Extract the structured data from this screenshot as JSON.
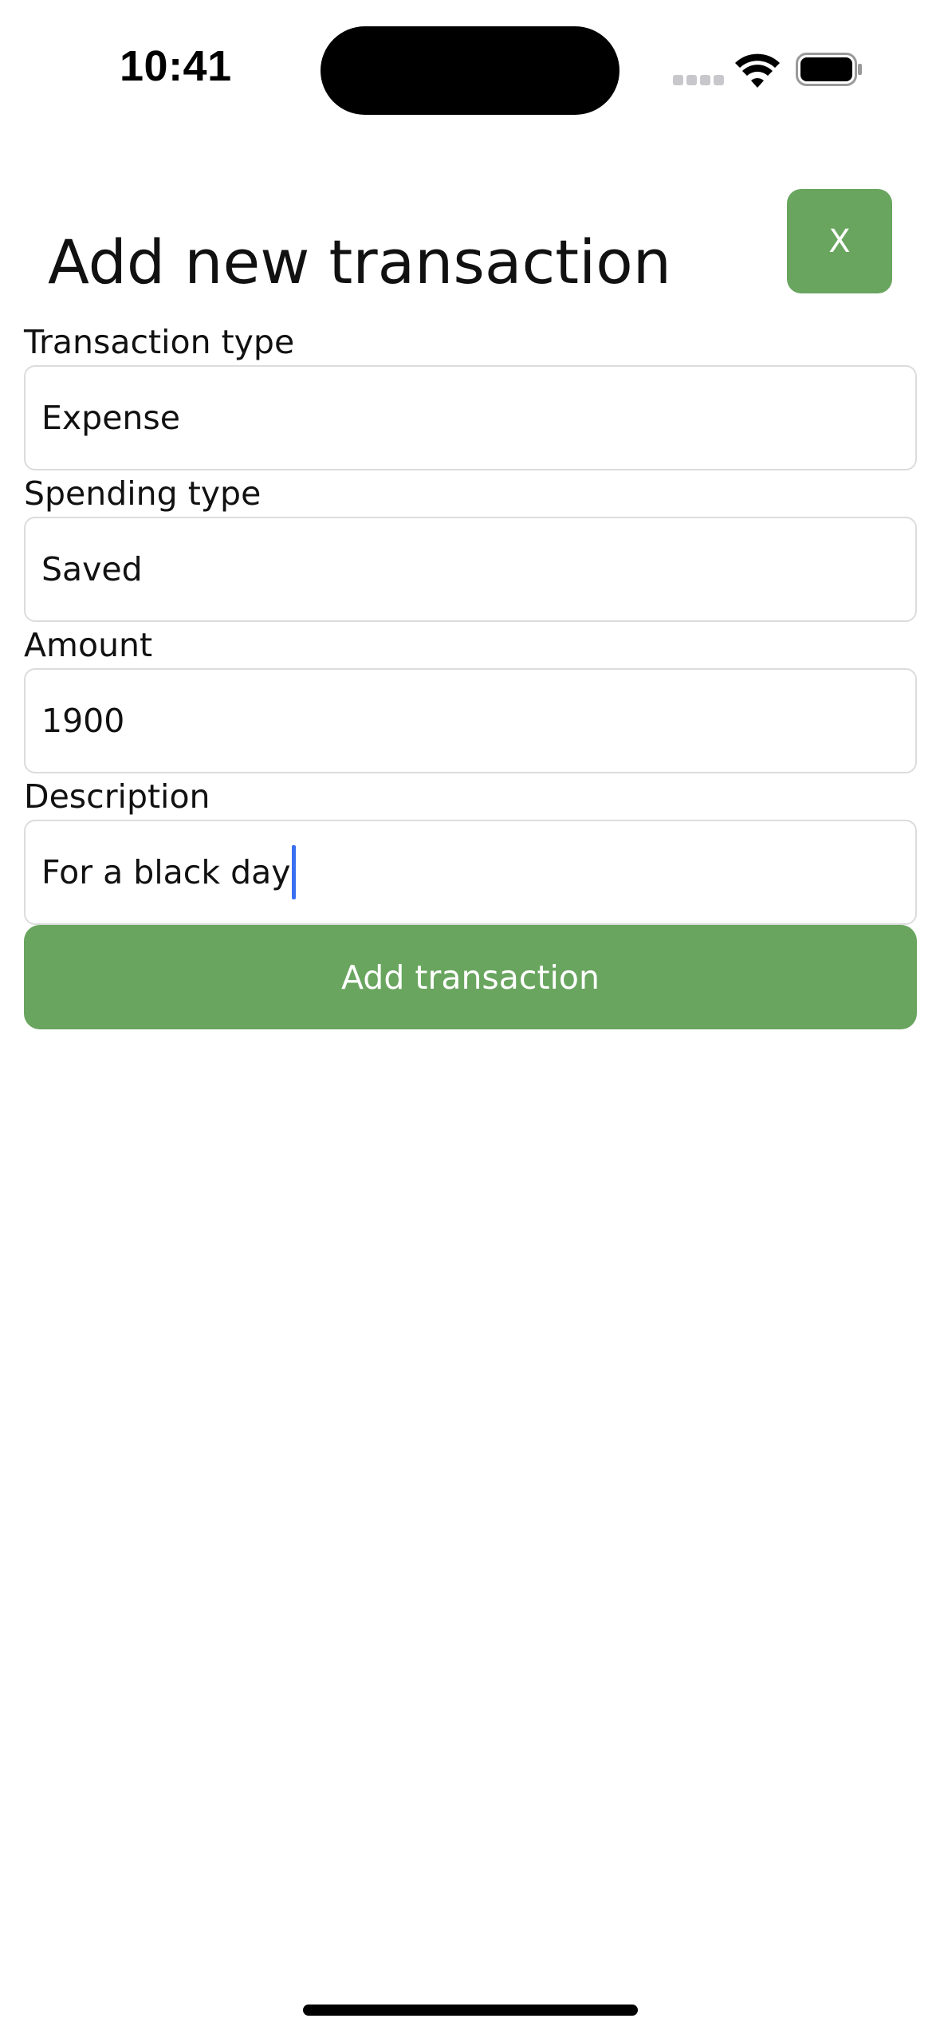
{
  "status_bar": {
    "time": "10:41",
    "icons": [
      "cellular-signal-icon",
      "wifi-icon",
      "battery-icon"
    ]
  },
  "header": {
    "title": "Add new transaction",
    "close_label": "X"
  },
  "form": {
    "transaction_type": {
      "label": "Transaction type",
      "value": "Expense"
    },
    "spending_type": {
      "label": "Spending type",
      "value": "Saved"
    },
    "amount": {
      "label": "Amount",
      "value": "1900"
    },
    "description": {
      "label": "Description",
      "value": "For a black day"
    },
    "submit_label": "Add transaction"
  },
  "colors": {
    "accent": "#69a55f",
    "caret": "#3a6ff2",
    "input_border": "#dcdcdc"
  }
}
